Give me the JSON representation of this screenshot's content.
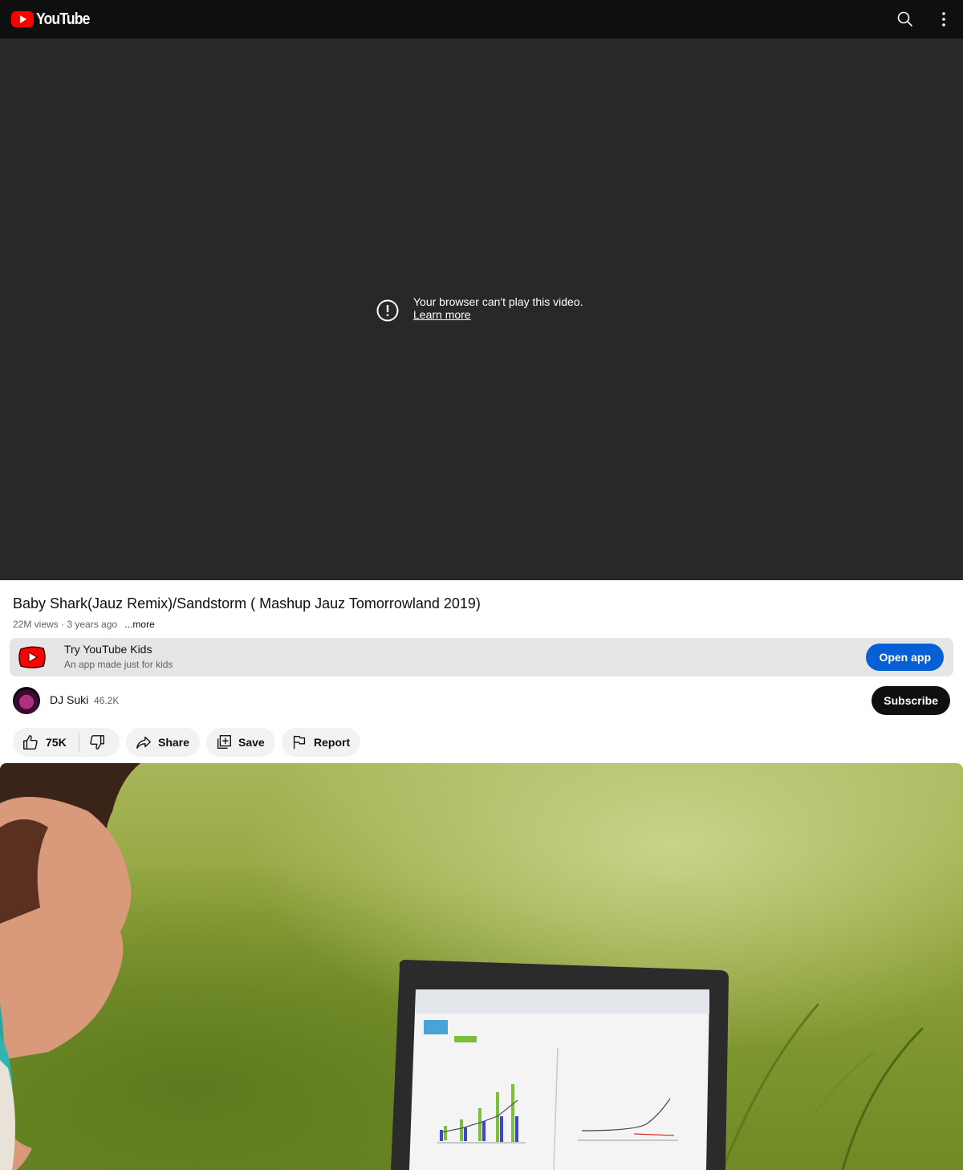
{
  "header": {
    "logo_text": "YouTube",
    "search_icon": "search-icon",
    "more_icon": "more-vert-icon"
  },
  "player": {
    "error_message": "Your browser can't play this video.",
    "learn_more": "Learn more"
  },
  "video": {
    "title": "Baby Shark(Jauz Remix)/Sandstorm ( Mashup Jauz Tomorrowland 2019)",
    "views_age": "22M views · 3 years ago",
    "more_label": "...more"
  },
  "kids_banner": {
    "title": "Try YouTube Kids",
    "subtitle": "An app made just for kids",
    "button_label": "Open app"
  },
  "channel": {
    "name": "DJ Suki",
    "subscribers": "46.2K",
    "subscribe_label": "Subscribe"
  },
  "actions": {
    "likes": "75K",
    "share_label": "Share",
    "save_label": "Save",
    "report_label": "Report"
  },
  "colors": {
    "brand_red": "#ff0000",
    "accent_blue": "#065fd4",
    "player_bg": "#282828"
  }
}
